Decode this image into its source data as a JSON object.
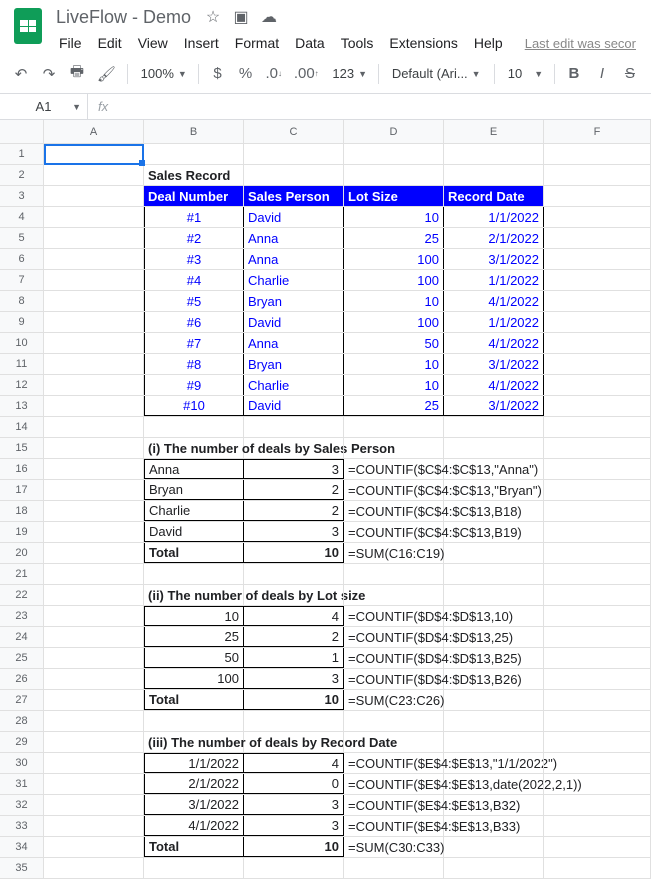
{
  "doc": {
    "title": "LiveFlow - Demo",
    "lastEdit": "Last edit was secor"
  },
  "menus": {
    "file": "File",
    "edit": "Edit",
    "view": "View",
    "insert": "Insert",
    "format": "Format",
    "data": "Data",
    "tools": "Tools",
    "extensions": "Extensions",
    "help": "Help"
  },
  "toolbar": {
    "zoom": "100%",
    "format123": "123",
    "font": "Default (Ari...",
    "size": "10"
  },
  "namebox": "A1",
  "columns": [
    "A",
    "B",
    "C",
    "D",
    "E",
    "F"
  ],
  "section_title": "Sales Record",
  "sales_headers": {
    "deal": "Deal Number",
    "person": "Sales Person",
    "lot": "Lot Size",
    "date": "Record Date"
  },
  "sales": [
    {
      "n": "#1",
      "p": "David",
      "l": "10",
      "d": "1/1/2022"
    },
    {
      "n": "#2",
      "p": "Anna",
      "l": "25",
      "d": "2/1/2022"
    },
    {
      "n": "#3",
      "p": "Anna",
      "l": "100",
      "d": "3/1/2022"
    },
    {
      "n": "#4",
      "p": "Charlie",
      "l": "100",
      "d": "1/1/2022"
    },
    {
      "n": "#5",
      "p": "Bryan",
      "l": "10",
      "d": "4/1/2022"
    },
    {
      "n": "#6",
      "p": "David",
      "l": "100",
      "d": "1/1/2022"
    },
    {
      "n": "#7",
      "p": "Anna",
      "l": "50",
      "d": "4/1/2022"
    },
    {
      "n": "#8",
      "p": "Bryan",
      "l": "10",
      "d": "3/1/2022"
    },
    {
      "n": "#9",
      "p": "Charlie",
      "l": "10",
      "d": "4/1/2022"
    },
    {
      "n": "#10",
      "p": "David",
      "l": "25",
      "d": "3/1/2022"
    }
  ],
  "sec1": {
    "title": "(i) The number of deals by Sales Person",
    "rows": [
      {
        "k": "Anna",
        "v": "3",
        "f": "=COUNTIF($C$4:$C$13,\"Anna\")"
      },
      {
        "k": "Bryan",
        "v": "2",
        "f": "=COUNTIF($C$4:$C$13,\"Bryan\")"
      },
      {
        "k": "Charlie",
        "v": "2",
        "f": "=COUNTIF($C$4:$C$13,B18)"
      },
      {
        "k": "David",
        "v": "3",
        "f": "=COUNTIF($C$4:$C$13,B19)"
      }
    ],
    "total": {
      "k": "Total",
      "v": "10",
      "f": "=SUM(C16:C19)"
    }
  },
  "sec2": {
    "title": "(ii) The number of deals by Lot size",
    "rows": [
      {
        "k": "10",
        "v": "4",
        "f": "=COUNTIF($D$4:$D$13,10)"
      },
      {
        "k": "25",
        "v": "2",
        "f": "=COUNTIF($D$4:$D$13,25)"
      },
      {
        "k": "50",
        "v": "1",
        "f": "=COUNTIF($D$4:$D$13,B25)"
      },
      {
        "k": "100",
        "v": "3",
        "f": "=COUNTIF($D$4:$D$13,B26)"
      }
    ],
    "total": {
      "k": "Total",
      "v": "10",
      "f": "=SUM(C23:C26)"
    }
  },
  "sec3": {
    "title": "(iii) The number of deals by Record Date",
    "rows": [
      {
        "k": "1/1/2022",
        "v": "4",
        "f": "=COUNTIF($E$4:$E$13,\"1/1/2022\")"
      },
      {
        "k": "2/1/2022",
        "v": "0",
        "f": "=COUNTIF($E$4:$E$13,date(2022,2,1))"
      },
      {
        "k": "3/1/2022",
        "v": "3",
        "f": "=COUNTIF($E$4:$E$13,B32)"
      },
      {
        "k": "4/1/2022",
        "v": "3",
        "f": "=COUNTIF($E$4:$E$13,B33)"
      }
    ],
    "total": {
      "k": "Total",
      "v": "10",
      "f": "=SUM(C30:C33)"
    }
  }
}
